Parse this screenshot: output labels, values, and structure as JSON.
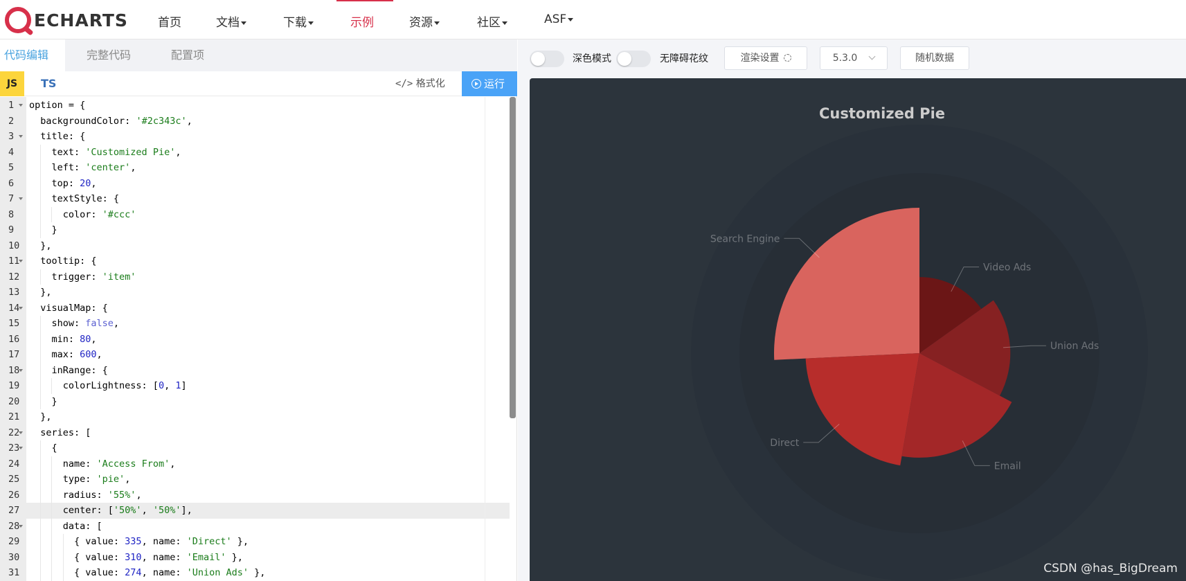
{
  "nav": {
    "logo_text": "ECHARTS",
    "items": [
      {
        "label": "首页",
        "dropdown": false,
        "active": false
      },
      {
        "label": "文档",
        "dropdown": true,
        "active": false
      },
      {
        "label": "下载",
        "dropdown": true,
        "active": false
      },
      {
        "label": "示例",
        "dropdown": false,
        "active": true
      },
      {
        "label": "资源",
        "dropdown": true,
        "active": false
      },
      {
        "label": "社区",
        "dropdown": true,
        "active": false
      },
      {
        "label": "ASF",
        "dropdown": true,
        "active": false
      }
    ]
  },
  "editor": {
    "tabs": [
      "代码编辑",
      "完整代码",
      "配置项"
    ],
    "active_tab": "代码编辑",
    "lang_js": "JS",
    "lang_ts": "TS",
    "format_label": "格式化",
    "format_icon": "code-icon",
    "run_label": "运行",
    "run_icon": "play-circle-icon",
    "highlighted_line": 27,
    "lines": [
      {
        "n": 1,
        "fold": true,
        "text": "option = {"
      },
      {
        "n": 2,
        "fold": false,
        "text": "  backgroundColor: '#2c343c',"
      },
      {
        "n": 3,
        "fold": true,
        "text": "  title: {"
      },
      {
        "n": 4,
        "fold": false,
        "text": "    text: 'Customized Pie',"
      },
      {
        "n": 5,
        "fold": false,
        "text": "    left: 'center',"
      },
      {
        "n": 6,
        "fold": false,
        "text": "    top: 20,"
      },
      {
        "n": 7,
        "fold": true,
        "text": "    textStyle: {"
      },
      {
        "n": 8,
        "fold": false,
        "text": "      color: '#ccc'"
      },
      {
        "n": 9,
        "fold": false,
        "text": "    }"
      },
      {
        "n": 10,
        "fold": false,
        "text": "  },"
      },
      {
        "n": 11,
        "fold": true,
        "text": "  tooltip: {"
      },
      {
        "n": 12,
        "fold": false,
        "text": "    trigger: 'item'"
      },
      {
        "n": 13,
        "fold": false,
        "text": "  },"
      },
      {
        "n": 14,
        "fold": true,
        "text": "  visualMap: {"
      },
      {
        "n": 15,
        "fold": false,
        "text": "    show: false,"
      },
      {
        "n": 16,
        "fold": false,
        "text": "    min: 80,"
      },
      {
        "n": 17,
        "fold": false,
        "text": "    max: 600,"
      },
      {
        "n": 18,
        "fold": true,
        "text": "    inRange: {"
      },
      {
        "n": 19,
        "fold": false,
        "text": "      colorLightness: [0, 1]"
      },
      {
        "n": 20,
        "fold": false,
        "text": "    }"
      },
      {
        "n": 21,
        "fold": false,
        "text": "  },"
      },
      {
        "n": 22,
        "fold": true,
        "text": "  series: ["
      },
      {
        "n": 23,
        "fold": true,
        "text": "    {"
      },
      {
        "n": 24,
        "fold": false,
        "text": "      name: 'Access From',"
      },
      {
        "n": 25,
        "fold": false,
        "text": "      type: 'pie',"
      },
      {
        "n": 26,
        "fold": false,
        "text": "      radius: '55%',"
      },
      {
        "n": 27,
        "fold": false,
        "text": "      center: ['50%', '50%'],"
      },
      {
        "n": 28,
        "fold": true,
        "text": "      data: ["
      },
      {
        "n": 29,
        "fold": false,
        "text": "        { value: 335, name: 'Direct' },"
      },
      {
        "n": 30,
        "fold": false,
        "text": "        { value: 310, name: 'Email' },"
      },
      {
        "n": 31,
        "fold": false,
        "text": "        { value: 274, name: 'Union Ads' },"
      }
    ]
  },
  "preview": {
    "dark_mode_label": "深色模式",
    "aria_label": "无障碍花纹",
    "render_settings_label": "渲染设置",
    "render_settings_icon": "gear-icon",
    "version": "5.3.0",
    "random_data_label": "随机数据",
    "watermark": "CSDN @has_BigDream",
    "background_color": "#2c343c"
  },
  "chart_data": {
    "type": "pie",
    "title": "Customized Pie",
    "rose_type": "radius",
    "slices": [
      {
        "name": "Search Engine",
        "value": 400,
        "color": "#d9645e"
      },
      {
        "name": "Video Ads",
        "value": 235,
        "color": "#6b1616"
      },
      {
        "name": "Union Ads",
        "value": 274,
        "color": "#862122"
      },
      {
        "name": "Email",
        "value": 310,
        "color": "#a32728"
      },
      {
        "name": "Direct",
        "value": 335,
        "color": "#b72d2b"
      }
    ]
  }
}
